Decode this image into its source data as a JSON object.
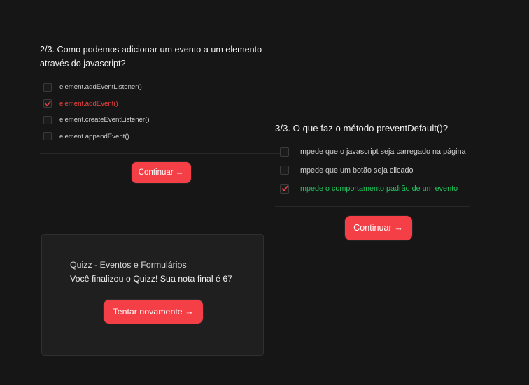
{
  "quiz_a": {
    "question": "2/3. Como podemos adicionar um evento a um elemento através do javascript?",
    "options": [
      {
        "label": "element.addEventListener()",
        "checked": false,
        "state": "neutral"
      },
      {
        "label": "element.addEvent()",
        "checked": true,
        "state": "wrong"
      },
      {
        "label": "element.createEventListener()",
        "checked": false,
        "state": "neutral"
      },
      {
        "label": "element.appendEvent()",
        "checked": false,
        "state": "neutral"
      }
    ],
    "continue_label": "Continuar →"
  },
  "quiz_b": {
    "question": "3/3. O que faz o método preventDefault()?",
    "options": [
      {
        "label": "Impede que o javascript seja carregado na página",
        "checked": false,
        "state": "neutral"
      },
      {
        "label": "Impede que um botão seja clicado",
        "checked": false,
        "state": "neutral"
      },
      {
        "label": "Impede o comportamento padrão de um evento",
        "checked": true,
        "state": "right"
      }
    ],
    "continue_label": "Continuar →"
  },
  "result": {
    "title": "Quizz - Eventos e Formulários",
    "message": "Você finalizou o Quizz! Sua nota final é 67",
    "retry_label": "Tentar novamente →"
  },
  "icons": {
    "checkmark": "check-icon"
  },
  "colors": {
    "background": "#161616",
    "accent_button": "#f43f46",
    "wrong": "#ef4444",
    "right": "#22c55e",
    "card": "#1f1f1f"
  }
}
